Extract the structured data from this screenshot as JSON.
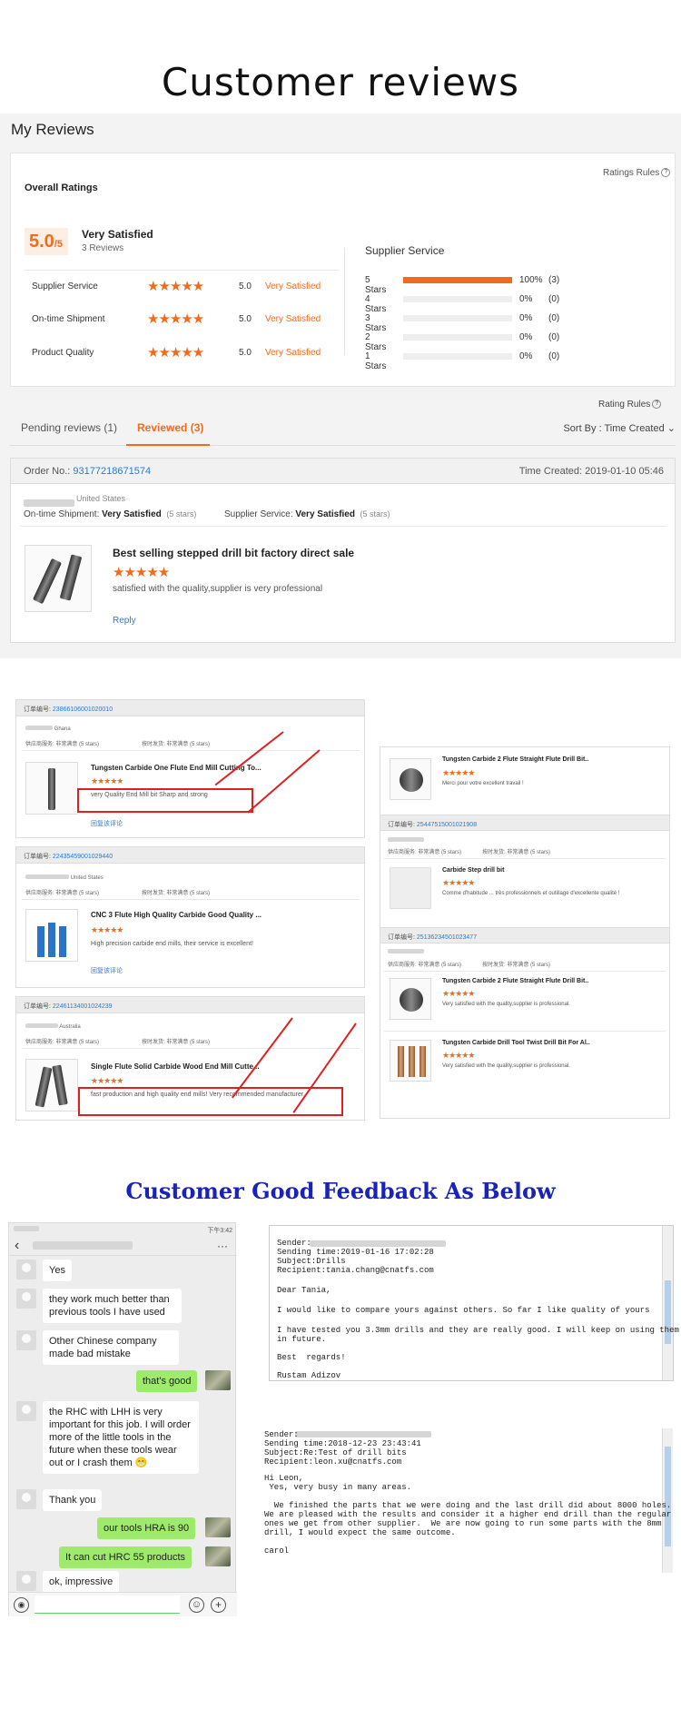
{
  "title": "Customer reviews",
  "my_reviews": "My Reviews",
  "ratings_rules": "Ratings Rules",
  "overall_ratings": "Overall Ratings",
  "score": "5.0",
  "score_max": "/5",
  "very_satisfied": "Very Satisfied",
  "review_count": "3 Reviews",
  "rating_rows": [
    {
      "label": "Supplier Service",
      "stars": "★★★★★",
      "num": "5.0",
      "sat": "Very Satisfied"
    },
    {
      "label": "On-time Shipment",
      "stars": "★★★★★",
      "num": "5.0",
      "sat": "Very Satisfied"
    },
    {
      "label": "Product Quality",
      "stars": "★★★★★",
      "num": "5.0",
      "sat": "Very Satisfied"
    }
  ],
  "supplier_service": "Supplier Service",
  "breakdown": [
    {
      "label": "5 Stars",
      "pct": "100%",
      "count": "(3)",
      "fill": 1.0
    },
    {
      "label": "4 Stars",
      "pct": "0%",
      "count": "(0)",
      "fill": 0
    },
    {
      "label": "3 Stars",
      "pct": "0%",
      "count": "(0)",
      "fill": 0
    },
    {
      "label": "2 Stars",
      "pct": "0%",
      "count": "(0)",
      "fill": 0
    },
    {
      "label": "1 Stars",
      "pct": "0%",
      "count": "(0)",
      "fill": 0
    }
  ],
  "rating_rules": "Rating Rules",
  "tabs": {
    "pending": "Pending reviews (1)",
    "reviewed": "Reviewed (3)",
    "sort": "Sort By : Time Created"
  },
  "order": {
    "no_label": "Order No.:",
    "no": "93177218671574",
    "time": "Time Created: 2019-01-10 05:46",
    "country": "United States",
    "ship_label": "On-time Shipment:",
    "ship_val": "Very Satisfied",
    "ship_stars": "(5 stars)",
    "svc_label": "Supplier Service:",
    "svc_val": "Very Satisfied",
    "svc_stars": "(5 stars)",
    "product": "Best selling stepped drill bit factory direct sale",
    "stars": "★★★★★",
    "comment": "satisfied with the quality,supplier is very professional",
    "reply": "Reply"
  },
  "shots": {
    "o1_label": "订单编号:",
    "o1_no": "23866106001020010",
    "o1_country": "Ghana",
    "svc": "供应商服务: 非常满意",
    "ship": "按时发货: 非常满意",
    "five": "(5 stars)",
    "o1_title": "Tungsten Carbide One Flute End Mill Cutting To...",
    "o1_comment": "very Quality End Mill bit Sharp and strong",
    "reply_cn": "回复该评论",
    "o2_no": "22435459001029440",
    "o2_country": "United States",
    "o2_title": "CNC 3 Flute High Quality Carbide Good Quality ...",
    "o2_comment": "High precision carbide end mills, their service is excellent!",
    "o3_no": "22461134001024239",
    "o3_country": "Australia",
    "o3_title": "Single Flute Solid Carbide Wood End Mill Cutte...",
    "o3_comment": "fast production and high quality end mills! Very recommended manufacturer.",
    "r1_title": "Tungsten Carbide 2 Flute Straight Flute Drill Bit..",
    "r1_comment": "Merci pour votre excellent travail !",
    "r2_no": "25447515001021908",
    "r2_title": "Carbide Step drill bit",
    "r2_comment": "Comme d'habitude ... très professionnels et outillage d'excellente qualité !",
    "r3_no": "25136234501023477",
    "r3_title": "Tungsten Carbide 2 Flute Straight Flute Drill Bit..",
    "r3_comment": "Very satisfied with the quality,supplier is professional.",
    "r4_title": "Tungsten Carbide Drill Tool Twist Drill Bit For Al..",
    "r4_comment": "Very satisfied with the quality,supplier is professional.",
    "stars": "★★★★★"
  },
  "feedback_title": "Customer Good Feedback As Below",
  "chat": {
    "time": "下午3:42",
    "back": "‹",
    "more": "···",
    "messages": [
      {
        "text": "Yes"
      },
      {
        "text": "they work much better than previous tools I have used"
      },
      {
        "text": "Other Chinese company made bad mistake"
      },
      {
        "text": "that's good"
      },
      {
        "text": "the RHC with LHH is very important for this job.  I will order more of the little tools in the future when these tools wear out or I crash them 😁"
      },
      {
        "text": "Thank you"
      },
      {
        "text": "our tools HRA is 90"
      },
      {
        "text": "It can cut HRC 55 products"
      },
      {
        "text": "ok, impressive"
      }
    ]
  },
  "email1": [
    "Sender:",
    "Sending time:2019-01-16 17:02:28",
    "Subject:Drills",
    "Recipient:tania.chang@cnatfs.com",
    "Dear Tania,",
    "I would like to compare yours against others. So far I like quality of yours",
    "I have tested you 3.3mm drills and they are really good. I will keep on using them",
    "in future.",
    "Best  regards!",
    "Rustam Adizov"
  ],
  "email2": [
    "Sender:",
    "Sending time:2018-12-23 23:43:41",
    "Subject:Re:Test of drill bits",
    "Recipient:leon.xu@cnatfs.com",
    "Hi Leon,",
    " Yes, very busy in many areas.",
    "  We finished the parts that we were doing and the last drill did about 8000 holes.",
    "We are pleased with the results and consider it a higher end drill than the regular",
    "ones we get from other supplier.  We are now going to run some parts with the 8mm",
    "drill, I would expect the same outcome.",
    "carol"
  ],
  "colors": {
    "accent": "#f26b1d",
    "link": "#2b7ad4",
    "feedback_blue": "#1a23b8",
    "red": "#e02020",
    "chat_green": "#9eea6a"
  }
}
